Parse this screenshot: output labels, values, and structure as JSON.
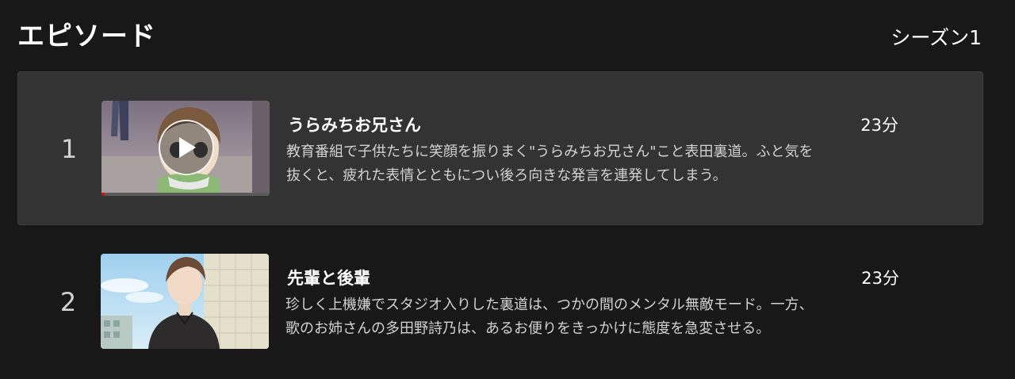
{
  "header": {
    "title": "エピソード",
    "season_label": "シーズン1"
  },
  "episodes": [
    {
      "index": "1",
      "title": "うらみちお兄さん",
      "duration": "23分",
      "description_line1": "教育番組で子供たちに笑顔を振りまく\"うらみちお兄さん\"こと表田裏道。ふと気を",
      "description_line2": "抜くと、疲れた表情とともについ後ろ向きな発言を連発してしまう。",
      "watch_progress": 0.02,
      "thumbnail_icon": "play-icon"
    },
    {
      "index": "2",
      "title": "先輩と後輩",
      "duration": "23分",
      "description_line1": "珍しく上機嫌でスタジオ入りした裏道は、つかの間のメンタル無敵モード。一方、",
      "description_line2": "歌のお姉さんの多田野詩乃は、あるお便りをきっかけに態度を急変させる。"
    }
  ],
  "colors": {
    "background": "#181818",
    "active_row": "#333333",
    "progress": "#e50914"
  }
}
